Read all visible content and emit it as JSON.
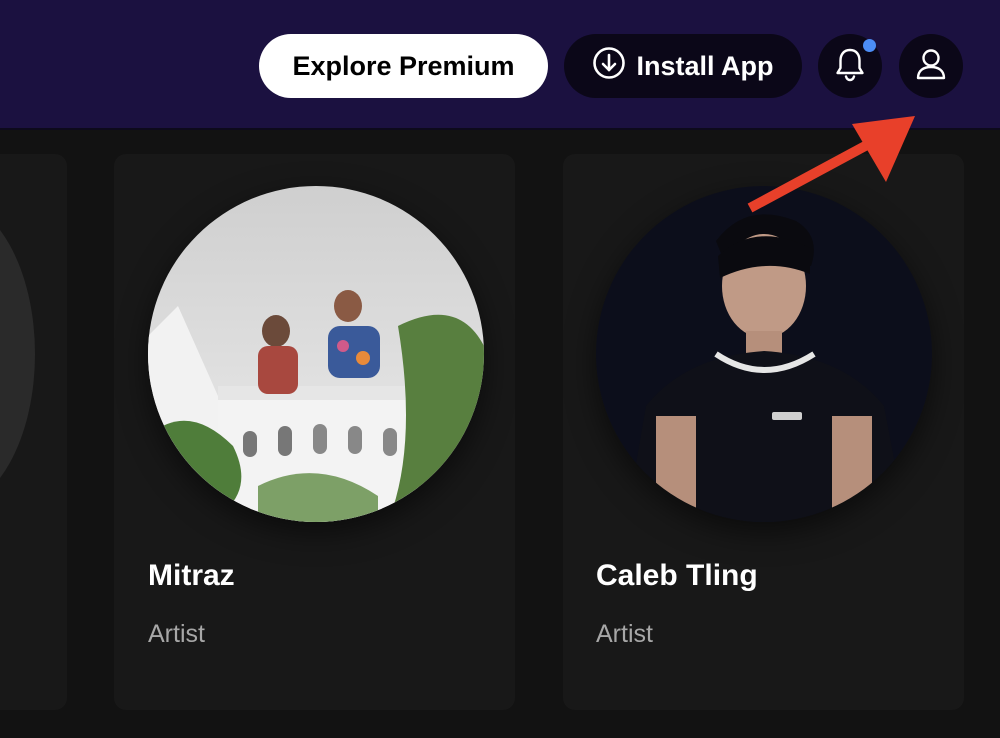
{
  "header": {
    "premium_label": "Explore Premium",
    "install_label": "Install App",
    "install_icon": "download-circle-icon",
    "bell_icon": "bell-icon",
    "profile_icon": "user-icon",
    "notification_dot_color": "#4c8df6",
    "background_color": "#1b1140"
  },
  "artists": [
    {
      "name": "Mitraz",
      "type": "Artist"
    },
    {
      "name": "Caleb Tling",
      "type": "Artist"
    }
  ],
  "annotation": {
    "arrow_color": "#e8402a",
    "points_to": "profile-button"
  }
}
